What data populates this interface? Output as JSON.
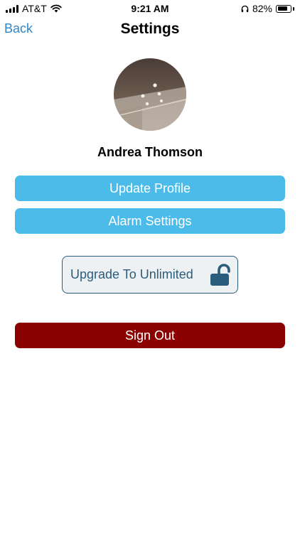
{
  "status_bar": {
    "carrier": "AT&T",
    "time": "9:21 AM",
    "battery_percent": "82%",
    "battery_level": 0.82,
    "icons": [
      "signal-icon",
      "wifi-icon",
      "headphones-icon",
      "battery-icon"
    ]
  },
  "nav": {
    "back_label": "Back",
    "title": "Settings"
  },
  "profile": {
    "name": "Andrea Thomson",
    "avatar": "profile-photo"
  },
  "buttons": {
    "update_profile": "Update Profile",
    "alarm_settings": "Alarm Settings",
    "upgrade": "Upgrade To Unlimited",
    "upgrade_icon": "unlocked-padlock-icon",
    "sign_out": "Sign Out"
  },
  "colors": {
    "accent_blue": "#4bbbea",
    "back_link": "#2f86c9",
    "upgrade_border": "#2a5d7c",
    "sign_out_red": "#8b0000"
  }
}
